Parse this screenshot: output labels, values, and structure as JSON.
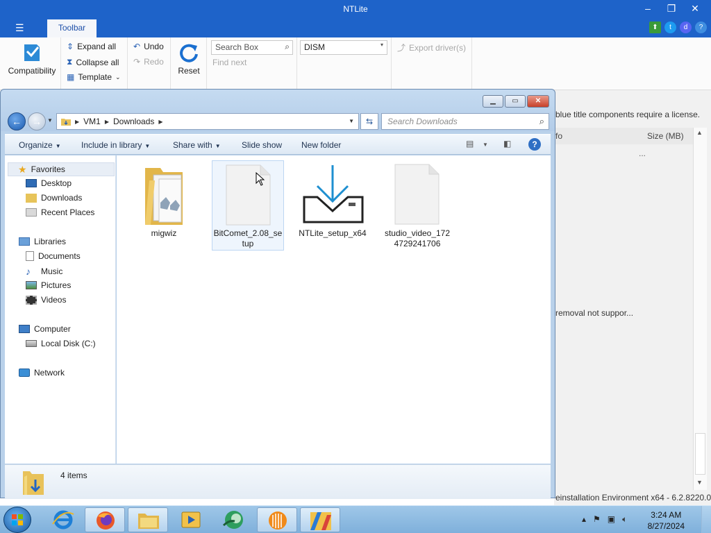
{
  "ntlite": {
    "title": "NTLite",
    "menu_tab": "Toolbar",
    "ribbon": {
      "compatibility": "Compatibility",
      "expand_all": "Expand all",
      "collapse_all": "Collapse all",
      "template": "Template",
      "undo": "Undo",
      "redo": "Redo",
      "reset": "Reset",
      "search_placeholder": "Search Box",
      "find_next": "Find next",
      "dism_value": "DISM",
      "export_drivers": "Export driver(s)"
    },
    "license_note": "blue title components require a license.",
    "columns": {
      "info": "fo",
      "size": "Size (MB)"
    },
    "ellipsis": "...",
    "removal_note": "removal not suppor...",
    "status": "einstallation Environment x64 - 6.2.8220.0"
  },
  "explorer": {
    "address": [
      "VM1",
      "Downloads"
    ],
    "search_placeholder": "Search Downloads",
    "commands": {
      "organize": "Organize",
      "include": "Include in library",
      "share": "Share with",
      "slideshow": "Slide show",
      "new_folder": "New folder"
    },
    "nav": {
      "favorites": "Favorites",
      "desktop": "Desktop",
      "downloads": "Downloads",
      "recent": "Recent Places",
      "libraries": "Libraries",
      "documents": "Documents",
      "music": "Music",
      "pictures": "Pictures",
      "videos": "Videos",
      "computer": "Computer",
      "local_disk": "Local Disk (C:)",
      "network": "Network"
    },
    "files": {
      "f1": {
        "line1": "migwiz",
        "line2": ""
      },
      "f2": {
        "line1": "BitComet_2.08_se",
        "line2": "tup"
      },
      "f3": {
        "line1": "NTLite_setup_x64",
        "line2": ""
      },
      "f4": {
        "line1": "studio_video_172",
        "line2": "4729241706"
      }
    },
    "item_count": "4 items"
  },
  "taskbar": {
    "time": "3:24 AM",
    "date": "8/27/2024"
  },
  "colors": {
    "ntlite_blue": "#1e63c9",
    "explorer_frame": "#b9d1ea",
    "download_arrow": "#1e8fd0"
  }
}
